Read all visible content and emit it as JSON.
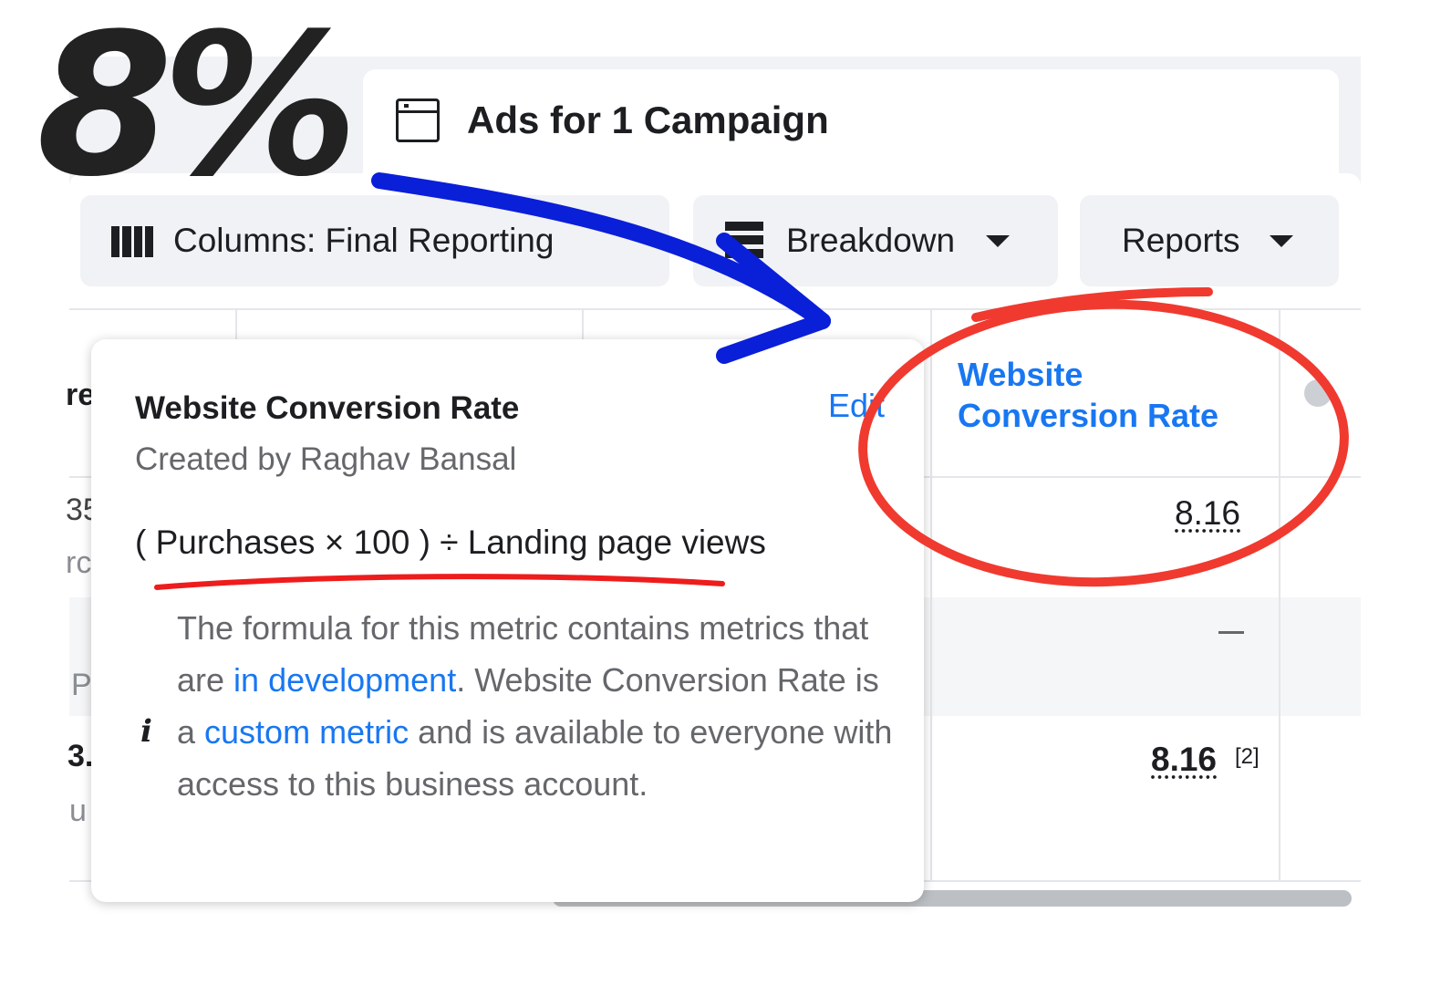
{
  "annotation": {
    "big_label": "8%"
  },
  "header": {
    "title": "Ads for 1 Campaign"
  },
  "toolbar": {
    "columns_label": "Columns: Final Reporting",
    "breakdown_label": "Breakdown",
    "reports_label": "Reports"
  },
  "table": {
    "highlighted_column_header": "Website Conversion Rate",
    "rows": [
      {
        "value": "8.16"
      },
      {
        "value": "—"
      },
      {
        "value": "8.16",
        "footnote": "[2]"
      }
    ],
    "left_fragments": [
      "re",
      "35",
      "rc",
      "P",
      "3.",
      "u"
    ]
  },
  "popup": {
    "title": "Website Conversion Rate",
    "edit_label": "Edit",
    "creator": "Created by Raghav Bansal",
    "formula": "( Purchases × 100 ) ÷ Landing page views",
    "note_part1": "The formula for this metric contains metrics that are ",
    "note_link1": "in development",
    "note_part2": ". Website Conversion Rate is a ",
    "note_link2": "custom metric",
    "note_part3": " and is available to everyone with access to this business account."
  },
  "colors": {
    "accent": "#1877f2",
    "annotation_arrow": "#0a1fd8",
    "annotation_circle": "#f03a2f",
    "toolbar_bg": "#f0f2f5"
  },
  "icons": [
    "window-icon",
    "columns-icon",
    "breakdown-icon",
    "caret-down-icon",
    "info-icon"
  ]
}
